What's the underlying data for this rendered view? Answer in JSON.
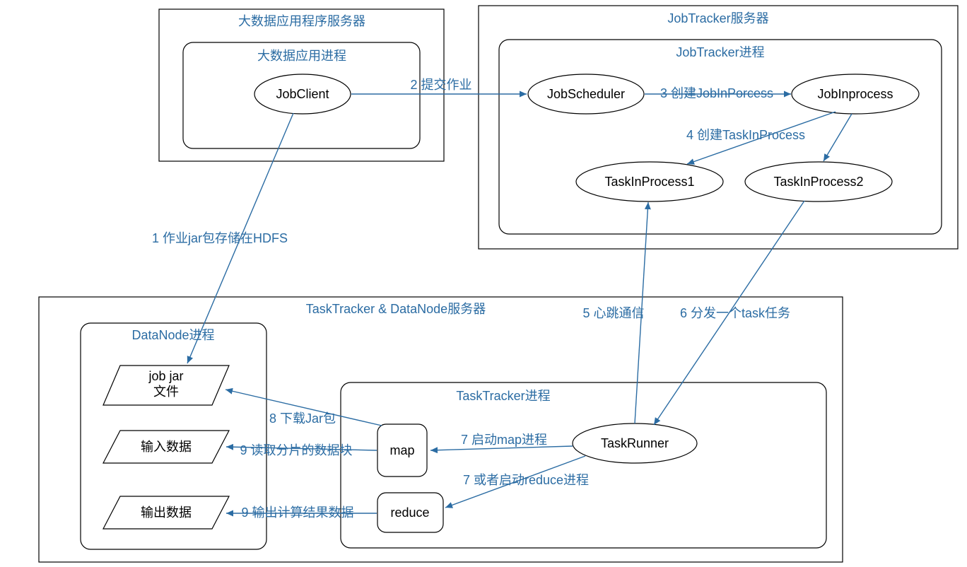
{
  "containers": {
    "appServer": "大数据应用程序服务器",
    "appProcess": "大数据应用进程",
    "jobTrackerServer": "JobTracker服务器",
    "jobTrackerProcess": "JobTracker进程",
    "ttDnServer": "TaskTracker & DataNode服务器",
    "dataNodeProcess": "DataNode进程",
    "taskTrackerProcess": "TaskTracker进程"
  },
  "nodes": {
    "jobClient": "JobClient",
    "jobScheduler": "JobScheduler",
    "jobInprocess": "JobInprocess",
    "taskInProcess1": "TaskInProcess1",
    "taskInProcess2": "TaskInProcess2",
    "jobJarFile1": "job jar",
    "jobJarFile2": "文件",
    "inputData": "输入数据",
    "outputData": "输出数据",
    "map": "map",
    "reduce": "reduce",
    "taskRunner": "TaskRunner"
  },
  "edges": {
    "e1": "1 作业jar包存储在HDFS",
    "e2": "2 提交作业",
    "e3": "3 创建JobInPorcess",
    "e4": "4 创建TaskInProcess",
    "e5": "5 心跳通信",
    "e6": "6 分发一个task任务",
    "e7a": "7 启动map进程",
    "e7b": "7 或者启动reduce进程",
    "e8": "8 下载Jar包",
    "e9a": "9 读取分片的数据块",
    "e9b": "9 输出计算结果数据"
  }
}
